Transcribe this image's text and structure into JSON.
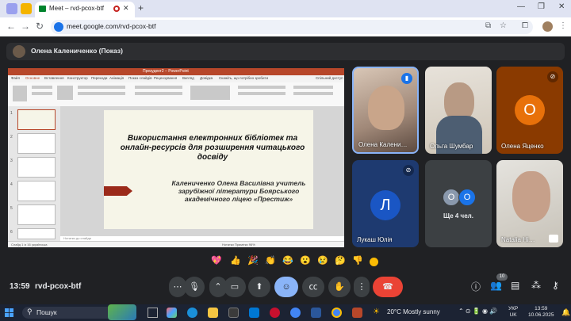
{
  "browser": {
    "tab_title": "Meet – rvd-pcox-btf",
    "tab_close": "✕",
    "new_tab": "+",
    "url": "meet.google.com/rvd-pcox-btf",
    "window_buttons": [
      "—",
      "❐",
      "✕"
    ]
  },
  "presenter": {
    "label": "Олена Калениченко (Показ)"
  },
  "powerpoint": {
    "title_bar": "Презудект2 – PowerPoint",
    "tabs": [
      "Файл",
      "Основне",
      "Вставлення",
      "Конструктор",
      "Переходи",
      "Анімація",
      "Показ слайдів",
      "Рецензування",
      "Вигляд",
      "Довідка",
      "Скажіть, що потрібно зробити",
      "Спільний доступ"
    ],
    "slide_numbers": [
      "1",
      "2",
      "3",
      "4",
      "5",
      "6"
    ],
    "slide_heading": "Використання електронних бібліотек та онлайн-ресурсів для розширення читацького досвіду",
    "slide_author": "Калениченко Олена Василівна учитель зарубіжної літератури Боярського академічного ліцею «Престиж»",
    "notes_placeholder": "Нотатки до слайда",
    "status_left": "Слайд 1 із 16   українська",
    "status_right": "Нотатки   Примітки   96%"
  },
  "participants": [
    {
      "name": "Олена Калени…",
      "kind": "video",
      "speaking": true
    },
    {
      "name": "Ольга Шумбар",
      "kind": "video"
    },
    {
      "name": "Олена Яценко",
      "kind": "avatar",
      "letter": "О",
      "color": "#e8710a",
      "bg": "#8a3a00",
      "muted": true
    },
    {
      "name": "Лукаш Юлія",
      "kind": "avatar",
      "letter": "Л",
      "color": "#1a56c4",
      "bg": "#1e3a70",
      "muted": true
    },
    {
      "name": "Ще 4 чел.",
      "kind": "more",
      "letters": [
        "О",
        "О"
      ]
    },
    {
      "name": "Natalia Hi…",
      "kind": "video"
    }
  ],
  "reactions": [
    "💖",
    "👍",
    "🎉",
    "👏",
    "😂",
    "😮",
    "😢",
    "🤔",
    "👎"
  ],
  "controls": {
    "clock": "13:59",
    "meeting_code": "rvd-pcox-btf",
    "people_count": "10"
  },
  "taskbar": {
    "search": "Пошук",
    "weather": "20°C  Mostly sunny",
    "lang_1": "УКР",
    "lang_2": "UK",
    "time": "13:59",
    "date": "10.06.2025"
  },
  "colors": {
    "end_call": "#ea4335",
    "present_active": "#8ab4f8",
    "ppt_red": "#b7472a"
  }
}
